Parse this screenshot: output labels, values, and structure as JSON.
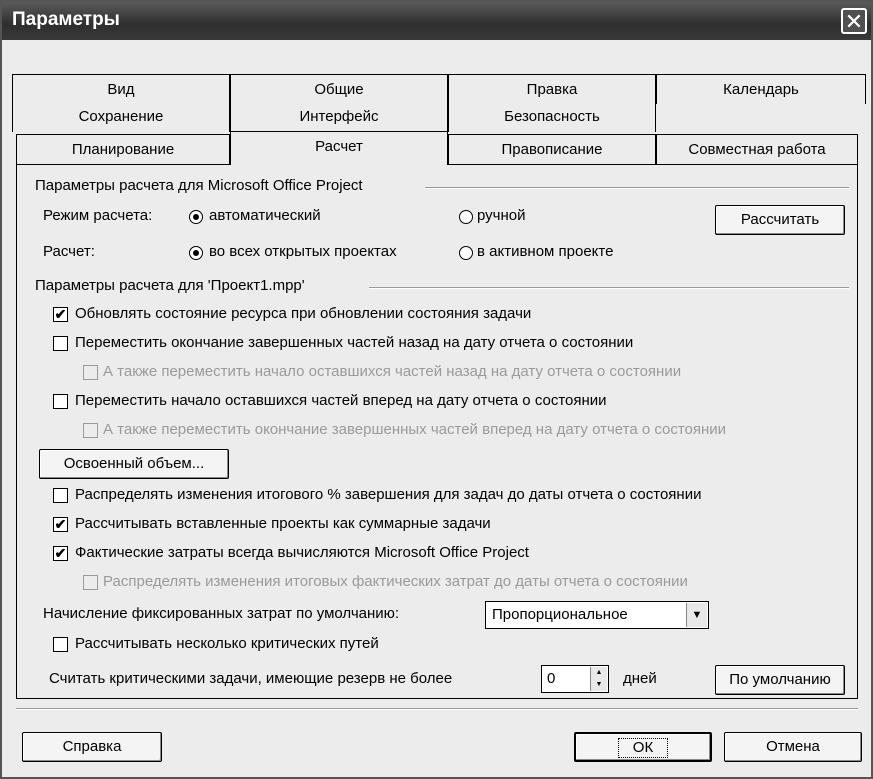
{
  "window": {
    "title": "Параметры",
    "close_glyph": "✕"
  },
  "tabs": {
    "row1": [
      "Вид",
      "Общие",
      "Правка",
      "Календарь"
    ],
    "row2": [
      "Сохранение",
      "Интерфейс",
      "Безопасность"
    ],
    "row3": [
      "Планирование",
      "Расчет",
      "Правописание",
      "Совместная работа"
    ],
    "active": "Расчет"
  },
  "group1": {
    "title": "Параметры расчета для Microsoft Office Project",
    "mode_label": "Режим расчета:",
    "mode_auto": "автоматический",
    "mode_manual": "ручной",
    "calc_button": "Рассчитать",
    "scope_label": "Расчет:",
    "scope_all": "во всех открытых проектах",
    "scope_active": "в активном проекте"
  },
  "group2": {
    "title": "Параметры расчета для 'Проект1.mpp'",
    "opt1": "Обновлять состояние ресурса при обновлении состояния задачи",
    "opt2": "Переместить окончание завершенных частей назад на дату отчета о состоянии",
    "opt2a": "А также переместить начало оставшихся частей назад на дату отчета о состоянии",
    "opt3": "Переместить начало оставшихся частей вперед на дату отчета о состоянии",
    "opt3a": "А также переместить окончание завершенных частей вперед на дату отчета о состоянии",
    "earned_value_button": "Освоенный объем...",
    "opt4": "Распределять изменения итогового % завершения для задач до даты отчета о состоянии",
    "opt5": "Рассчитывать вставленные проекты как суммарные задачи",
    "opt6": "Фактические затраты всегда вычисляются Microsoft Office Project",
    "opt6a": "Распределять изменения итоговых фактических затрат до даты отчета о состоянии",
    "fixed_cost_label": "Начисление фиксированных затрат по умолчанию:",
    "fixed_cost_value": "Пропорциональное",
    "opt7": "Рассчитывать несколько критических путей",
    "critical_label": "Считать критическими задачи, имеющие резерв не более",
    "critical_value": "0",
    "critical_unit": "дней",
    "default_button": "По умолчанию"
  },
  "footer": {
    "help": "Справка",
    "ok": "ОК",
    "cancel": "Отмена"
  },
  "checked_mark": "✔"
}
